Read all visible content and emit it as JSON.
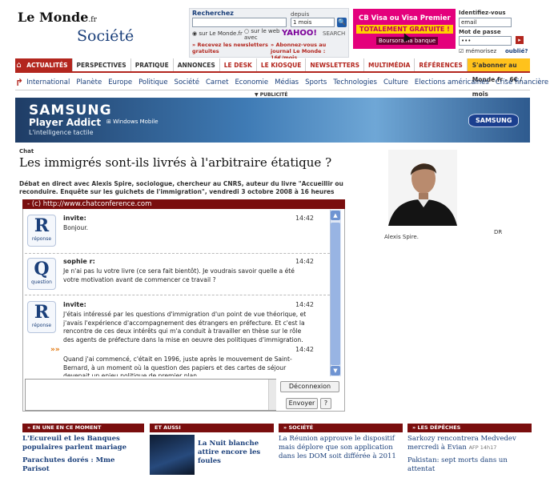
{
  "header": {
    "logo": "Le Monde",
    "logo_suffix": ".fr",
    "section_title": "Société"
  },
  "search": {
    "label": "Recherchez",
    "depuis_label": "depuis",
    "depuis_value": "1 mois",
    "go_label": "🔍",
    "radio_lemonde": "◉ sur Le Monde.fr",
    "radio_web": "○ sur le web avec",
    "yahoo": "YAHOO!",
    "yahoo_search": "SEARCH",
    "newsletter_link": "» Recevez les newsletters gratuites",
    "abonnez_link": "» Abonnez-vous au journal Le Monde : 16€/mois"
  },
  "promo": {
    "title": "CB Visa ou Visa Premier",
    "free": "TOTALEMENT GRATUITE !",
    "sub": "Boursorama banque"
  },
  "login": {
    "ident_label": "Identifiez-vous",
    "email_value": "email",
    "pass_label": "Mot de passe",
    "pass_value": "•••",
    "go_label": "▸",
    "remember": "☑ mémorisez",
    "forgot": "oublié?"
  },
  "mainnav": {
    "home_icon": "⌂",
    "tabs": [
      {
        "label": "ACTUALITÉS",
        "style": "active"
      },
      {
        "label": "PERSPECTIVES",
        "style": ""
      },
      {
        "label": "PRATIQUE",
        "style": ""
      },
      {
        "label": "ANNONCES",
        "style": ""
      },
      {
        "label": "LE DESK",
        "style": "red"
      },
      {
        "label": "LE KIOSQUE",
        "style": "red"
      },
      {
        "label": "NEWSLETTERS",
        "style": "red"
      },
      {
        "label": "MULTIMÉDIA",
        "style": "red"
      },
      {
        "label": "RÉFÉRENCES",
        "style": "red"
      }
    ],
    "subscribe": "S'abonner au Monde.fr - 6€ / mois"
  },
  "subnav": {
    "arrow": "↱",
    "items": [
      "International",
      "Planète",
      "Europe",
      "Politique",
      "Société",
      "Carnet",
      "Economie",
      "Médias",
      "Sports",
      "Technologies",
      "Culture",
      "Elections américaines",
      "Crise financière"
    ]
  },
  "pub_label": "▼ PUBLICITÉ",
  "banner": {
    "brand": "SAMSUNG",
    "product": "Player Addict",
    "tag": "L'intelligence tactile",
    "os": "⊞ Windows Mobile",
    "logo": "SAMSUNG"
  },
  "article": {
    "kicker": "Chat",
    "title": "Les immigrés sont-ils livrés à l'arbitraire étatique ?",
    "lead": "Débat en direct avec Alexis Spire, sociologue, chercheur au CNRS, auteur du livre \"Accueillir ou reconduire. Enquête sur les guichets de l'immigration\", vendredi 3 octobre 2008 à 16 heures",
    "photo_caption": "Alexis Spire.",
    "photo_credit": "DR"
  },
  "chat": {
    "topbar": "- (c) http://www.chatconference.com",
    "messages": [
      {
        "badge": "R",
        "kind": "réponse",
        "author": "invite:",
        "time": "14:42",
        "text": "Bonjour."
      },
      {
        "badge": "Q",
        "kind": "question",
        "author": "sophie r:",
        "time": "14:42",
        "text": "Je n'ai pas lu votre livre (ce sera fait bientôt). Je voudrais savoir quelle a été votre motivation avant de commencer ce travail ?"
      },
      {
        "badge": "R",
        "kind": "réponse",
        "author": "invite:",
        "time": "14:42",
        "text": "J'étais intéressé par les questions d'immigration d'un point de vue théorique, et j'avais l'expérience d'accompagnement des étrangers en préfecture. Et c'est la rencontre de ces deux intérêts qui m'a conduit à travailler en thèse sur le rôle des agents de préfecture dans la mise en oeuvre des politiques d'immigration."
      },
      {
        "marker": "»»",
        "time": "14:42",
        "text": "Quand j'ai commencé, c'était en 1996, juste après le mouvement de Saint-Bernard, à un moment où la question des papiers et des cartes de séjour devenait un enjeu politique de premier plan."
      }
    ],
    "disconnect_label": "Déconnexion",
    "send_label": "Envoyer",
    "help_label": "?"
  },
  "sections": [
    {
      "head": "» EN UNE EN CE MOMENT",
      "items": [
        "L'Ecureuil et les Banques populaires parlent mariage",
        "Parachutes dorés : Mme Parisot"
      ]
    },
    {
      "head": "ET AUSSI",
      "items": [
        "La Nuit blanche attire encore les foules"
      ]
    },
    {
      "head": "» SOCIÉTÉ",
      "items": [
        "La Réunion approuve le dispositif mais déplore que son application dans les DOM soit différée à 2011"
      ]
    },
    {
      "head": "» LES DÉPÊCHES",
      "items": [
        "Sarkozy rencontrera Medvedev mercredi à Evian",
        "Pakistan: sept morts dans un attentat"
      ],
      "meta": "AFP 14h17"
    }
  ]
}
